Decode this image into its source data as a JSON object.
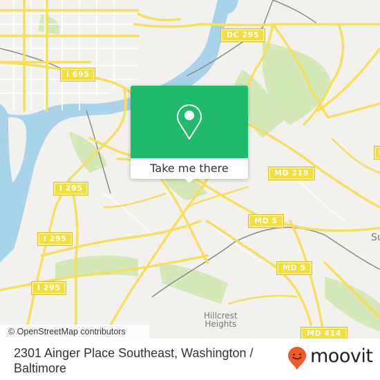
{
  "map": {
    "colors": {
      "background": "#f2f1ee",
      "water": "#a9d3ea",
      "park": "#d4e8b8",
      "road_major": "#f6df5c",
      "road_minor": "#ffffff",
      "rail": "#8a8a8a",
      "popup_green": "#1fba6a",
      "moovit_orange": "#f05a28"
    },
    "shields": [
      {
        "id": "dc295",
        "label": "DC 295"
      },
      {
        "id": "i695",
        "label": "I 695"
      },
      {
        "id": "i295a",
        "label": "I 295"
      },
      {
        "id": "i295b",
        "label": "I 295"
      },
      {
        "id": "i295c",
        "label": "I 295"
      },
      {
        "id": "md218",
        "label": "MD 218"
      },
      {
        "id": "md5a",
        "label": "MD 5"
      },
      {
        "id": "md5b",
        "label": "MD 5"
      },
      {
        "id": "md414",
        "label": "MD 414"
      },
      {
        "id": "md_edge",
        "label": "M"
      }
    ],
    "places": [
      {
        "id": "hillcrest",
        "line1": "Hillcrest",
        "line2": "Heights"
      },
      {
        "id": "suitland",
        "line1": "Su"
      }
    ],
    "attribution": "© OpenStreetMap contributors"
  },
  "popup": {
    "icon": "map-pin-icon",
    "button_label": "Take me there"
  },
  "footer": {
    "address": "2301 Ainger Place Southeast, Washington / Baltimore",
    "brand": "moovit",
    "brand_icon": "moovit-smiley-pin-icon"
  }
}
